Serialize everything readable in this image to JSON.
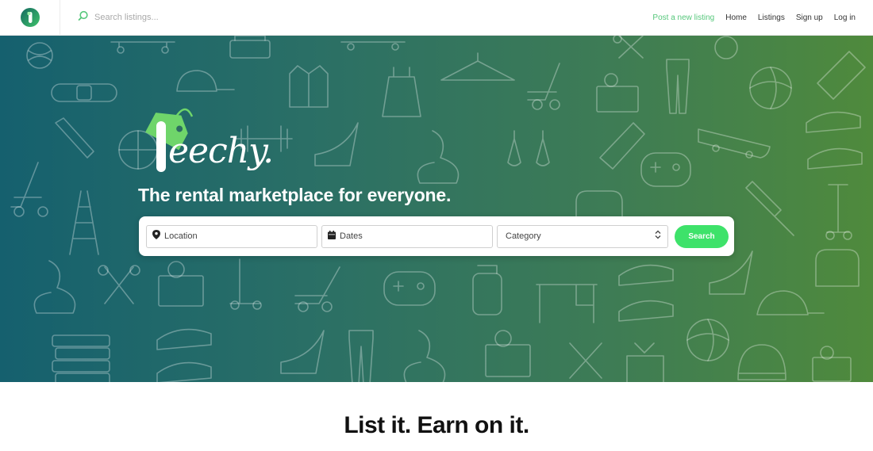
{
  "nav": {
    "search_placeholder": "Search listings...",
    "links": [
      {
        "label": "Post a new listing"
      },
      {
        "label": "Home"
      },
      {
        "label": "Listings"
      },
      {
        "label": "Sign up"
      },
      {
        "label": "Log in"
      }
    ]
  },
  "hero": {
    "brand_name": "eechy.",
    "tagline": "The rental marketplace for everyone.",
    "search": {
      "location_placeholder": "Location",
      "dates_placeholder": "Dates",
      "category_value": "Category",
      "button_label": "Search"
    }
  },
  "section": {
    "title": "List it. Earn on it."
  },
  "colors": {
    "accent": "#56c77b",
    "search_button": "#3ee26a",
    "hero_gradient_start": "#15606e",
    "hero_gradient_end": "#4f8a3c",
    "tag_green": "#6fd56a"
  },
  "icons": [
    "app-logo-icon",
    "search-icon",
    "location-pin-icon",
    "calendar-icon",
    "chevron-updown-icon",
    "price-tag-icon"
  ]
}
